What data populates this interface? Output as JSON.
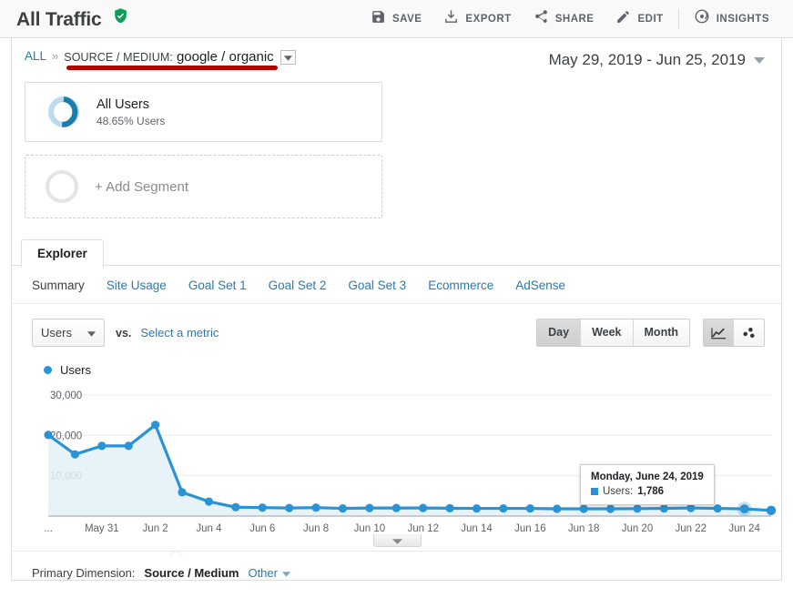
{
  "header": {
    "title": "All Traffic",
    "verified_icon": "verified-shield-icon",
    "toolbar": [
      {
        "label": "SAVE",
        "icon": "save-icon"
      },
      {
        "label": "EXPORT",
        "icon": "export-download-icon"
      },
      {
        "label": "SHARE",
        "icon": "share-icon"
      },
      {
        "label": "EDIT",
        "icon": "pencil-edit-icon"
      },
      {
        "label": "INSIGHTS",
        "icon": "insights-icon"
      }
    ]
  },
  "breadcrumb": {
    "all_label": "ALL",
    "separator": "»",
    "key": "SOURCE / MEDIUM:",
    "value": "google / organic",
    "caret_icon": "chevron-down-icon",
    "highlight_color": "#b00000"
  },
  "date_range": {
    "text": "May 29, 2019 - Jun 25, 2019",
    "caret_icon": "chevron-down-icon"
  },
  "segments": {
    "applied": {
      "name": "All Users",
      "sub": "48.65% Users",
      "percent": 48.65,
      "arc_color": "#1a7db0",
      "ring_color": "#bcdcee"
    },
    "add_label": "+ Add Segment"
  },
  "explorer": {
    "tab_label": "Explorer",
    "subtabs": [
      {
        "label": "Summary",
        "active": true
      },
      {
        "label": "Site Usage",
        "active": false
      },
      {
        "label": "Goal Set 1",
        "active": false
      },
      {
        "label": "Goal Set 2",
        "active": false
      },
      {
        "label": "Goal Set 3",
        "active": false
      },
      {
        "label": "Ecommerce",
        "active": false
      },
      {
        "label": "AdSense",
        "active": false
      }
    ]
  },
  "metric_row": {
    "metric_label": "Users",
    "metric_caret_icon": "chevron-down-icon",
    "vs_label": "vs.",
    "select_metric_label": "Select a metric",
    "granularity": [
      {
        "label": "Day",
        "active": true
      },
      {
        "label": "Week",
        "active": false
      },
      {
        "label": "Month",
        "active": false
      }
    ],
    "chart_types": [
      {
        "icon": "line-chart-icon",
        "active": true
      },
      {
        "icon": "motion-chart-icon",
        "active": false
      }
    ]
  },
  "legend": {
    "series_label": "Users",
    "color": "#2a93d5"
  },
  "tooltip": {
    "title": "Monday, June 24, 2019",
    "metric_label": "Users:",
    "value": "1,786",
    "swatch_color": "#2a93d5"
  },
  "chart_handle_icon": "chevron-down-icon",
  "primary_dimension": {
    "label": "Primary Dimension:",
    "value": "Source / Medium",
    "other_label": "Other",
    "other_caret_icon": "chevron-down-icon"
  },
  "chart_data": {
    "type": "line",
    "title": "Users",
    "xlabel": "",
    "ylabel": "Users",
    "ylim": [
      0,
      30000
    ],
    "yticks": [
      10000,
      20000,
      30000
    ],
    "ytick_labels": [
      "10,000",
      "20,000",
      "30,000"
    ],
    "grid": true,
    "legend": "Users",
    "series_color": "#2a93d5",
    "fill_color": "#e4f0f8",
    "x_axis_leading_ellipsis": "...",
    "xtick_labels": [
      "May 31",
      "Jun 2",
      "Jun 4",
      "Jun 6",
      "Jun 8",
      "Jun 10",
      "Jun 12",
      "Jun 14",
      "Jun 16",
      "Jun 18",
      "Jun 20",
      "Jun 22",
      "Jun 24"
    ],
    "x": [
      "May 29",
      "May 30",
      "May 31",
      "Jun 1",
      "Jun 2",
      "Jun 3",
      "Jun 4",
      "Jun 5",
      "Jun 6",
      "Jun 7",
      "Jun 8",
      "Jun 9",
      "Jun 10",
      "Jun 11",
      "Jun 12",
      "Jun 13",
      "Jun 14",
      "Jun 15",
      "Jun 16",
      "Jun 17",
      "Jun 18",
      "Jun 19",
      "Jun 20",
      "Jun 21",
      "Jun 22",
      "Jun 23",
      "Jun 24",
      "Jun 25"
    ],
    "series": [
      {
        "name": "Users",
        "values": [
          20100,
          15300,
          17400,
          17400,
          22600,
          5900,
          3600,
          2200,
          2100,
          2000,
          2100,
          1900,
          2000,
          2000,
          2000,
          1950,
          1900,
          1900,
          1900,
          1800,
          1800,
          1800,
          1850,
          1900,
          2000,
          1900,
          1786,
          1400
        ]
      }
    ],
    "hover_point": {
      "x": "Jun 24",
      "value": 1786
    }
  }
}
